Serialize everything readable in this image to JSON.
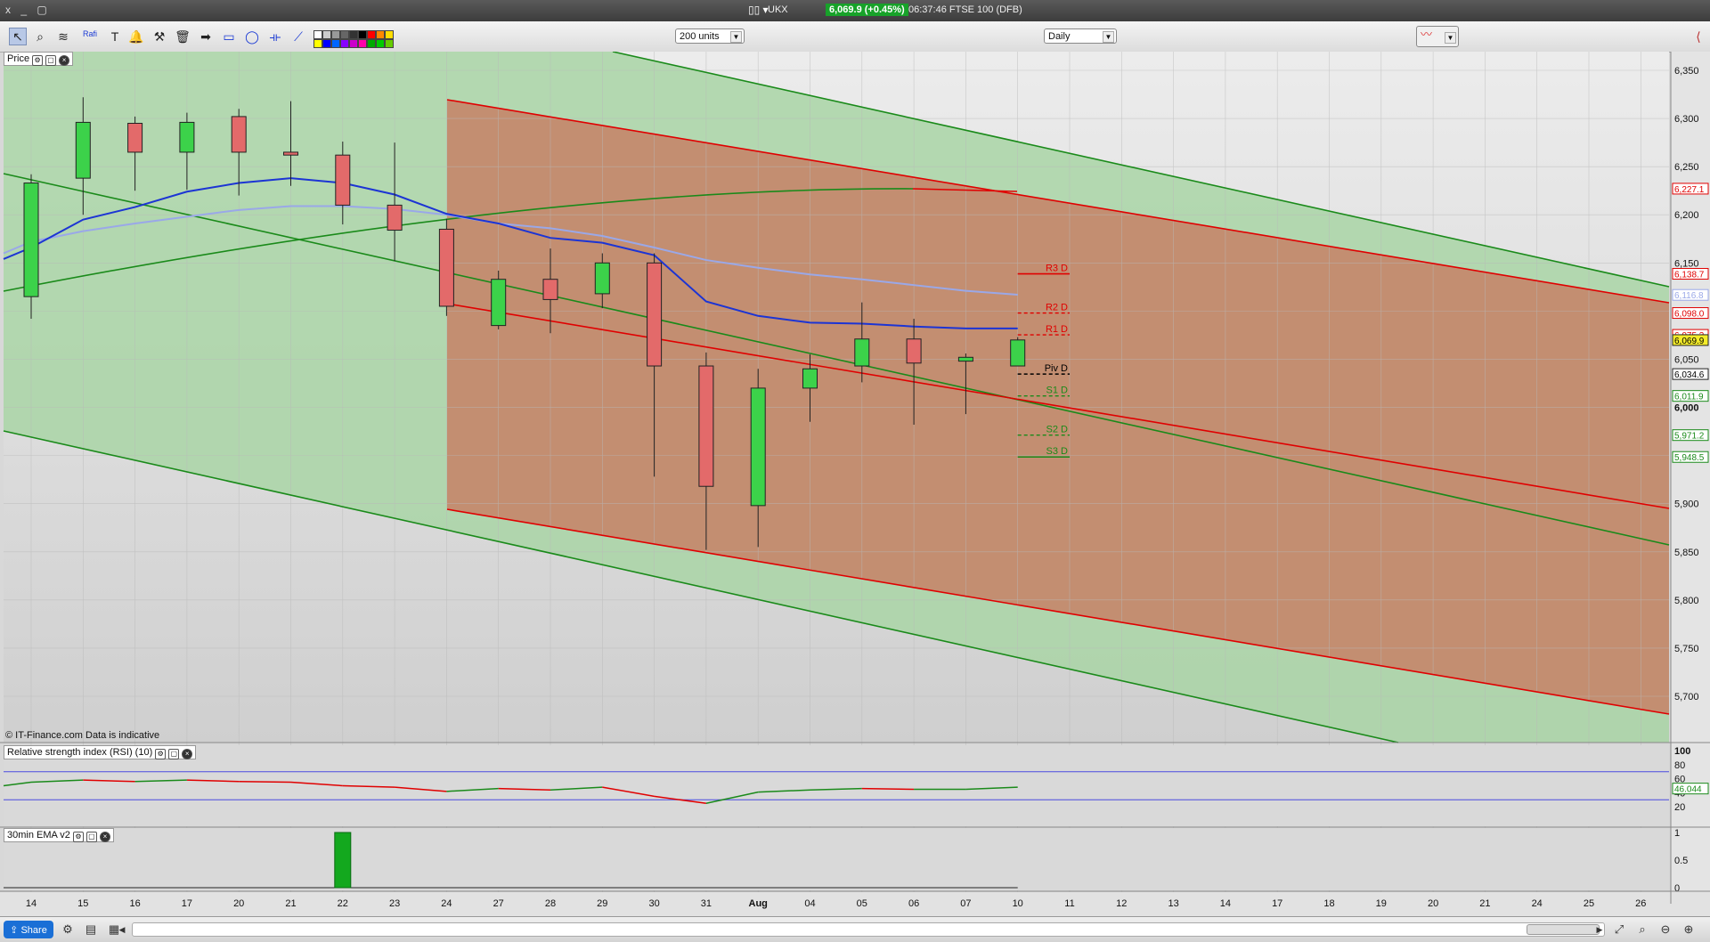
{
  "window": {
    "controls": "x _ ▢",
    "instrument": "UKX",
    "price": "6,069.9 (+0.45%)",
    "time_info": "06:37:46 FTSE 100 (DFB)"
  },
  "toolbar": {
    "units": "200 units",
    "interval": "Daily",
    "fib_label": "Rafi"
  },
  "panels": {
    "price": "Price",
    "rsi": "Relative strength index (RSI) (10)",
    "ema": "30min EMA v2"
  },
  "copyright": "© IT-Finance.com  Data is indicative",
  "share": "Share",
  "colors": {
    "bull": "#3cd24a",
    "bear": "#e36a6a",
    "red_line": "#e00000",
    "green_line": "#1a8a1a",
    "ema_fast": "#1c34d4",
    "ema_slow": "#9aa8e8",
    "channel_red": "#c48a6e",
    "channel_green": "#a9d5a6"
  },
  "icons": [
    "pointer-icon",
    "zoom-icon",
    "fib-icon",
    "text-icon",
    "alert-icon",
    "tools-icon",
    "trash-icon",
    "arrow-icon",
    "rect-icon",
    "ellipse-icon",
    "hline-icon",
    "pen-icon"
  ],
  "chart_data": {
    "type": "candlestick",
    "x_labels": [
      "14",
      "15",
      "16",
      "17",
      "20",
      "21",
      "22",
      "23",
      "24",
      "27",
      "28",
      "29",
      "30",
      "31",
      "Aug",
      "04",
      "05",
      "06",
      "07",
      "10",
      "11",
      "12",
      "13",
      "14",
      "17",
      "18",
      "19",
      "20",
      "21",
      "24",
      "25",
      "26"
    ],
    "y_ticks": [
      "6,350",
      "6,300",
      "6,250",
      "6,200",
      "6,150",
      "6,100",
      "6,050",
      "6,000",
      "5,950",
      "5,900",
      "5,850",
      "5,800",
      "5,750",
      "5,700"
    ],
    "ylim": [
      5660,
      6370
    ],
    "candles": [
      {
        "o": 6115,
        "h": 6242,
        "l": 6092,
        "c": 6233
      },
      {
        "o": 6238,
        "h": 6322,
        "l": 6200,
        "c": 6296
      },
      {
        "o": 6295,
        "h": 6302,
        "l": 6225,
        "c": 6265
      },
      {
        "o": 6265,
        "h": 6306,
        "l": 6226,
        "c": 6296
      },
      {
        "o": 6302,
        "h": 6310,
        "l": 6220,
        "c": 6265
      },
      {
        "o": 6265,
        "h": 6318,
        "l": 6230,
        "c": 6262
      },
      {
        "o": 6262,
        "h": 6276,
        "l": 6190,
        "c": 6210
      },
      {
        "o": 6210,
        "h": 6275,
        "l": 6152,
        "c": 6184
      },
      {
        "o": 6185,
        "h": 6196,
        "l": 6095,
        "c": 6105
      },
      {
        "o": 6085,
        "h": 6142,
        "l": 6081,
        "c": 6133
      },
      {
        "o": 6133,
        "h": 6165,
        "l": 6077,
        "c": 6112
      },
      {
        "o": 6118,
        "h": 6160,
        "l": 6103,
        "c": 6150
      },
      {
        "o": 6150,
        "h": 6160,
        "l": 5928,
        "c": 6043
      },
      {
        "o": 6043,
        "h": 6057,
        "l": 5852,
        "c": 5918
      },
      {
        "o": 5898,
        "h": 6040,
        "l": 5855,
        "c": 6020
      },
      {
        "o": 6020,
        "h": 6055,
        "l": 5985,
        "c": 6040
      },
      {
        "o": 6043,
        "h": 6109,
        "l": 6026,
        "c": 6071
      },
      {
        "o": 6071,
        "h": 6092,
        "l": 5982,
        "c": 6046
      },
      {
        "o": 6048,
        "h": 6056,
        "l": 5993,
        "c": 6052
      },
      {
        "o": 6043,
        "h": 6073,
        "l": 6043,
        "c": 6070
      }
    ],
    "ema_fast": [
      6166,
      6195,
      6208,
      6224,
      6233,
      6238,
      6233,
      6221,
      6201,
      6191,
      6176,
      6171,
      6158,
      6110,
      6095,
      6088,
      6087,
      6084,
      6082,
      6082
    ],
    "ema_slow": [
      6172,
      6183,
      6191,
      6198,
      6205,
      6209,
      6209,
      6206,
      6200,
      6191,
      6186,
      6178,
      6166,
      6153,
      6145,
      6138,
      6133,
      6127,
      6121,
      6117
    ],
    "pivots": [
      {
        "label": "R3 D",
        "value": 6138.7,
        "color": "#e00000",
        "dash": false
      },
      {
        "label": "R2 D",
        "value": 6098.0,
        "color": "#e00000",
        "dash": true
      },
      {
        "label": "R1 D",
        "value": 6075.3,
        "color": "#e00000",
        "dash": true
      },
      {
        "label": "Piv D",
        "value": 6034.6,
        "color": "#000000",
        "dash": true
      },
      {
        "label": "S1 D",
        "value": 6011.9,
        "color": "#1a8a1a",
        "dash": true
      },
      {
        "label": "S2 D",
        "value": 5971.2,
        "color": "#1a8a1a",
        "dash": true
      },
      {
        "label": "S3 D",
        "value": 5948.5,
        "color": "#1a8a1a",
        "dash": false
      }
    ],
    "price_tags": [
      {
        "text": "6,227.1",
        "value": 6227.1,
        "color": "#e00000",
        "text_color": "#e00000",
        "bg": "#fff"
      },
      {
        "text": "6,138.7",
        "value": 6138.7,
        "color": "#e00000",
        "text_color": "#e00000",
        "bg": "#fff"
      },
      {
        "text": "6,116.8",
        "value": 6116.8,
        "color": "#9aa8e8",
        "text_color": "#9aa8e8",
        "bg": "#fff"
      },
      {
        "text": "6,098.0",
        "value": 6098.0,
        "color": "#e00000",
        "text_color": "#e00000",
        "bg": "#fff"
      },
      {
        "text": "6,075.3",
        "value": 6075.3,
        "color": "#e00000",
        "text_color": "#e00000",
        "bg": "#fff"
      },
      {
        "text": "6,069.9",
        "value": 6069.9,
        "color": "#222",
        "text_color": "#000",
        "bg": "#f4ec2a"
      },
      {
        "text": "6,034.6",
        "value": 6034.6,
        "color": "#222",
        "text_color": "#000",
        "bg": "#fff"
      },
      {
        "text": "6,011.9",
        "value": 6011.9,
        "color": "#1a8a1a",
        "text_color": "#1a8a1a",
        "bg": "#fff"
      },
      {
        "text": "5,971.2",
        "value": 5971.2,
        "color": "#1a8a1a",
        "text_color": "#1a8a1a",
        "bg": "#fff"
      },
      {
        "text": "5,948.5",
        "value": 5948.5,
        "color": "#1a8a1a",
        "text_color": "#1a8a1a",
        "bg": "#fff"
      }
    ],
    "rsi": {
      "ticks": [
        "100",
        "80",
        "60",
        "40",
        "20"
      ],
      "ylim": [
        0,
        100
      ],
      "values": [
        50,
        55,
        58,
        56,
        58,
        56,
        55,
        50,
        48,
        42,
        46,
        44,
        48,
        35,
        25,
        41,
        44,
        46,
        45,
        45,
        48
      ],
      "last_label": "46.044",
      "bands": [
        70,
        30
      ]
    },
    "ema_panel": {
      "ticks": [
        "1",
        "0.5",
        "0"
      ],
      "ylim": [
        0,
        1
      ],
      "signal_index": 6,
      "signal_value": 1
    }
  }
}
